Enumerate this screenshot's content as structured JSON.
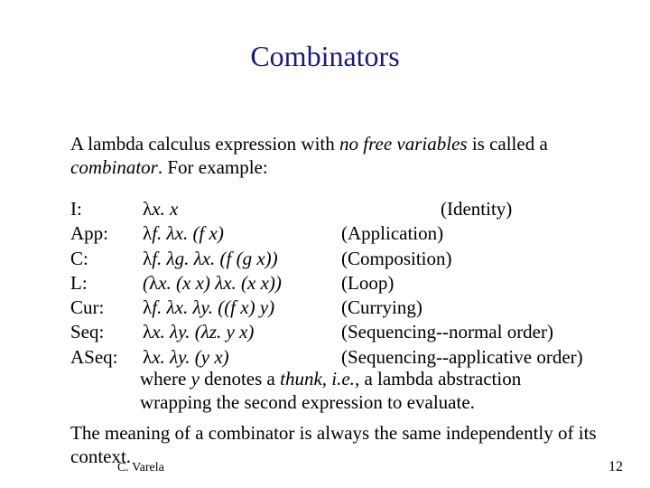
{
  "title": "Combinators",
  "intro": {
    "pre": "A lambda calculus expression with ",
    "nfv": "no free variables",
    "mid": " is called a ",
    "comb": "combinator",
    "post": ".  For example:"
  },
  "lambda": "λ",
  "rows": [
    {
      "label": "I:",
      "expr": "x. x",
      "desc": "(Identity)"
    },
    {
      "label": "App:",
      "expr": "f. λx. (f x)",
      "desc": "(Application)"
    },
    {
      "label": "C:",
      "expr": "f. λg. λx. (f (g x))",
      "desc": "(Composition)"
    },
    {
      "label": "L:",
      "expr_prefix": "(",
      "expr": "x. (x x) λx. (x x))",
      "desc": "(Loop)"
    },
    {
      "label": "Cur:",
      "expr": "f. λx. λy. ((f x) y)",
      "desc": "(Currying)"
    },
    {
      "label": "Seq:",
      "expr": "x. λy. (λz. y x)",
      "desc": "(Sequencing--normal order)"
    },
    {
      "label": "ASeq:",
      "expr": "x. λy. (y x)",
      "desc": "(Sequencing--applicative order)"
    }
  ],
  "note": {
    "pre": "where ",
    "y": "y",
    "mid1": " denotes a ",
    "thunk": "thunk, i.e.",
    "post": ", a lambda abstraction wrapping the second expression to evaluate."
  },
  "meaning": "The meaning of a combinator is always the same independently of its context.",
  "footer": {
    "author": "C. Varela",
    "page": "12"
  }
}
